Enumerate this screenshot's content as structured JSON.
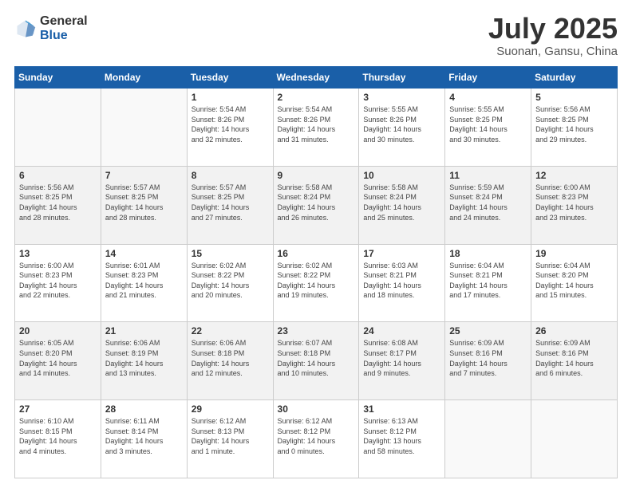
{
  "header": {
    "logo_general": "General",
    "logo_blue": "Blue",
    "title": "July 2025",
    "location": "Suonan, Gansu, China"
  },
  "weekdays": [
    "Sunday",
    "Monday",
    "Tuesday",
    "Wednesday",
    "Thursday",
    "Friday",
    "Saturday"
  ],
  "weeks": [
    [
      {
        "day": "",
        "info": ""
      },
      {
        "day": "",
        "info": ""
      },
      {
        "day": "1",
        "info": "Sunrise: 5:54 AM\nSunset: 8:26 PM\nDaylight: 14 hours\nand 32 minutes."
      },
      {
        "day": "2",
        "info": "Sunrise: 5:54 AM\nSunset: 8:26 PM\nDaylight: 14 hours\nand 31 minutes."
      },
      {
        "day": "3",
        "info": "Sunrise: 5:55 AM\nSunset: 8:26 PM\nDaylight: 14 hours\nand 30 minutes."
      },
      {
        "day": "4",
        "info": "Sunrise: 5:55 AM\nSunset: 8:25 PM\nDaylight: 14 hours\nand 30 minutes."
      },
      {
        "day": "5",
        "info": "Sunrise: 5:56 AM\nSunset: 8:25 PM\nDaylight: 14 hours\nand 29 minutes."
      }
    ],
    [
      {
        "day": "6",
        "info": "Sunrise: 5:56 AM\nSunset: 8:25 PM\nDaylight: 14 hours\nand 28 minutes."
      },
      {
        "day": "7",
        "info": "Sunrise: 5:57 AM\nSunset: 8:25 PM\nDaylight: 14 hours\nand 28 minutes."
      },
      {
        "day": "8",
        "info": "Sunrise: 5:57 AM\nSunset: 8:25 PM\nDaylight: 14 hours\nand 27 minutes."
      },
      {
        "day": "9",
        "info": "Sunrise: 5:58 AM\nSunset: 8:24 PM\nDaylight: 14 hours\nand 26 minutes."
      },
      {
        "day": "10",
        "info": "Sunrise: 5:58 AM\nSunset: 8:24 PM\nDaylight: 14 hours\nand 25 minutes."
      },
      {
        "day": "11",
        "info": "Sunrise: 5:59 AM\nSunset: 8:24 PM\nDaylight: 14 hours\nand 24 minutes."
      },
      {
        "day": "12",
        "info": "Sunrise: 6:00 AM\nSunset: 8:23 PM\nDaylight: 14 hours\nand 23 minutes."
      }
    ],
    [
      {
        "day": "13",
        "info": "Sunrise: 6:00 AM\nSunset: 8:23 PM\nDaylight: 14 hours\nand 22 minutes."
      },
      {
        "day": "14",
        "info": "Sunrise: 6:01 AM\nSunset: 8:23 PM\nDaylight: 14 hours\nand 21 minutes."
      },
      {
        "day": "15",
        "info": "Sunrise: 6:02 AM\nSunset: 8:22 PM\nDaylight: 14 hours\nand 20 minutes."
      },
      {
        "day": "16",
        "info": "Sunrise: 6:02 AM\nSunset: 8:22 PM\nDaylight: 14 hours\nand 19 minutes."
      },
      {
        "day": "17",
        "info": "Sunrise: 6:03 AM\nSunset: 8:21 PM\nDaylight: 14 hours\nand 18 minutes."
      },
      {
        "day": "18",
        "info": "Sunrise: 6:04 AM\nSunset: 8:21 PM\nDaylight: 14 hours\nand 17 minutes."
      },
      {
        "day": "19",
        "info": "Sunrise: 6:04 AM\nSunset: 8:20 PM\nDaylight: 14 hours\nand 15 minutes."
      }
    ],
    [
      {
        "day": "20",
        "info": "Sunrise: 6:05 AM\nSunset: 8:20 PM\nDaylight: 14 hours\nand 14 minutes."
      },
      {
        "day": "21",
        "info": "Sunrise: 6:06 AM\nSunset: 8:19 PM\nDaylight: 14 hours\nand 13 minutes."
      },
      {
        "day": "22",
        "info": "Sunrise: 6:06 AM\nSunset: 8:18 PM\nDaylight: 14 hours\nand 12 minutes."
      },
      {
        "day": "23",
        "info": "Sunrise: 6:07 AM\nSunset: 8:18 PM\nDaylight: 14 hours\nand 10 minutes."
      },
      {
        "day": "24",
        "info": "Sunrise: 6:08 AM\nSunset: 8:17 PM\nDaylight: 14 hours\nand 9 minutes."
      },
      {
        "day": "25",
        "info": "Sunrise: 6:09 AM\nSunset: 8:16 PM\nDaylight: 14 hours\nand 7 minutes."
      },
      {
        "day": "26",
        "info": "Sunrise: 6:09 AM\nSunset: 8:16 PM\nDaylight: 14 hours\nand 6 minutes."
      }
    ],
    [
      {
        "day": "27",
        "info": "Sunrise: 6:10 AM\nSunset: 8:15 PM\nDaylight: 14 hours\nand 4 minutes."
      },
      {
        "day": "28",
        "info": "Sunrise: 6:11 AM\nSunset: 8:14 PM\nDaylight: 14 hours\nand 3 minutes."
      },
      {
        "day": "29",
        "info": "Sunrise: 6:12 AM\nSunset: 8:13 PM\nDaylight: 14 hours\nand 1 minute."
      },
      {
        "day": "30",
        "info": "Sunrise: 6:12 AM\nSunset: 8:12 PM\nDaylight: 14 hours\nand 0 minutes."
      },
      {
        "day": "31",
        "info": "Sunrise: 6:13 AM\nSunset: 8:12 PM\nDaylight: 13 hours\nand 58 minutes."
      },
      {
        "day": "",
        "info": ""
      },
      {
        "day": "",
        "info": ""
      }
    ]
  ]
}
